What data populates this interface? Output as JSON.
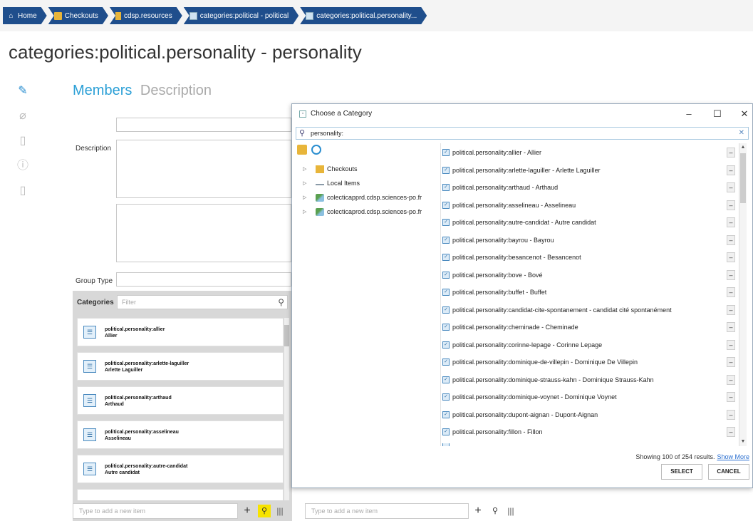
{
  "breadcrumb": [
    {
      "label": "Home",
      "icon": "home-icon"
    },
    {
      "label": "Checkouts",
      "icon": "folder-icon"
    },
    {
      "label": "cdsp.resources",
      "icon": "document-icon"
    },
    {
      "label": "categories:political - political",
      "icon": "category-icon"
    },
    {
      "label": "categories:political.personality...",
      "icon": "category-icon"
    }
  ],
  "page": {
    "title": "categories:political.personality - personality"
  },
  "rail": [
    "pencil-icon",
    "paperclip-icon",
    "document-icon",
    "info-icon",
    "document-icon"
  ],
  "tabs": {
    "members": "Members",
    "description": "Description"
  },
  "form": {
    "description_label": "Description",
    "group_type_label": "Group Type"
  },
  "categories_panel": {
    "header": "Categories",
    "filter_placeholder": "Filter",
    "items": [
      {
        "code": "political.personality:allier",
        "name": "Allier"
      },
      {
        "code": "political.personality:arlette-laguiller",
        "name": "Arlette Laguiller"
      },
      {
        "code": "political.personality:arthaud",
        "name": "Arthaud"
      },
      {
        "code": "political.personality:asselineau",
        "name": "Asselineau"
      },
      {
        "code": "political.personality:autre-candidat",
        "name": "Autre candidat"
      }
    ],
    "add_placeholder": "Type to add a new item"
  },
  "second_panel": {
    "add_placeholder": "Type to add a new item"
  },
  "dialog": {
    "title": "Choose a Category",
    "search_value": "personality:",
    "tree": [
      "Checkouts",
      "Local Items",
      "colecticapprd.cdsp.sciences-po.fr",
      "colecticaprod.cdsp.sciences-po.fr"
    ],
    "results": [
      "political.personality:allier - Allier",
      "political.personality:arlette-laguiller - Arlette Laguiller",
      "political.personality:arthaud - Arthaud",
      "political.personality:asselineau - Asselineau",
      "political.personality:autre-candidat - Autre candidat",
      "political.personality:bayrou - Bayrou",
      "political.personality:besancenot - Besancenot",
      "political.personality:bove - Bové",
      "political.personality:buffet - Buffet",
      "political.personality:candidat-cite-spontanement - candidat cité spontanément",
      "political.personality:cheminade - Cheminade",
      "political.personality:corinne-lepage - Corinne Lepage",
      "political.personality:dominique-de-villepin - Dominique De Villepin",
      "political.personality:dominique-strauss-kahn - Dominique Strauss-Kahn",
      "political.personality:dominique-voynet - Dominique Voynet",
      "political.personality:dupont-aignan - Dupont-Aignan",
      "political.personality:fillon - Fillon"
    ],
    "status": "Showing 100 of 254 results.",
    "show_more": "Show More",
    "select_label": "SELECT",
    "cancel_label": "CANCEL"
  }
}
